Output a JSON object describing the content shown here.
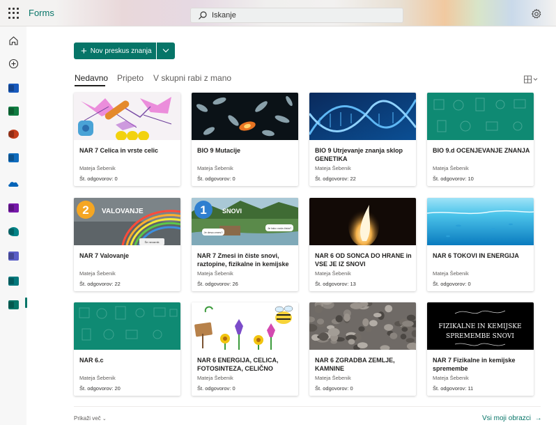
{
  "app": {
    "name": "Forms"
  },
  "search": {
    "placeholder": "Iskanje"
  },
  "rail": {
    "items": [
      {
        "name": "home-icon"
      },
      {
        "name": "create-icon"
      },
      {
        "name": "word-icon",
        "color": "#185abd"
      },
      {
        "name": "excel-icon",
        "color": "#107c41"
      },
      {
        "name": "powerpoint-icon",
        "color": "#c43e1c"
      },
      {
        "name": "outlook-icon",
        "color": "#0f6cbd"
      },
      {
        "name": "onedrive-icon",
        "color": "#0364b8"
      },
      {
        "name": "onenote-icon",
        "color": "#7719aa"
      },
      {
        "name": "sway-icon",
        "color": "#038387"
      },
      {
        "name": "teams-icon",
        "color": "#5b5fc7"
      },
      {
        "name": "sharepoint-icon",
        "color": "#03787c"
      },
      {
        "name": "forms-icon",
        "color": "#077568"
      }
    ]
  },
  "toolbar": {
    "new_quiz_label": "Nov preskus znanja"
  },
  "tabs": [
    "Nedavno",
    "Pripeto",
    "V skupni rabi z mano"
  ],
  "cards": [
    {
      "title": "NAR 7 Celica in vrste celic",
      "author": "Mateja Šebenik",
      "responses": "Št. odgovorov: 0",
      "thumb": "cells"
    },
    {
      "title": "BIO 9 Mutacije",
      "author": "Mateja Šebenik",
      "responses": "Št. odgovorov: 0",
      "thumb": "chromosomes"
    },
    {
      "title": "BIO 9 Utrjevanje znanja sklop GENETIKA",
      "author": "Mateja Šebenik",
      "responses": "Št. odgovorov: 22",
      "thumb": "dna"
    },
    {
      "title": "BIO 9.d OCENJEVANJE ZNANJA",
      "author": "Mateja Šebenik",
      "responses": "Št. odgovorov: 10",
      "thumb": "green"
    },
    {
      "title": "NAR 7 Valovanje",
      "author": "Mateja Šebenik",
      "responses": "Št. odgovorov: 22",
      "thumb": "rainbow",
      "badge": "2",
      "badge_text": "VALOVANJE",
      "bubble": "Še nevarnik"
    },
    {
      "title": "NAR 7 Zmesi in čiste snovi, raztopine, fizikalne in kemijske",
      "author": "Mateja Šebenik",
      "responses": "Št. odgovorov: 26",
      "thumb": "river",
      "badge": "1",
      "badge_text": "SNOVI",
      "bubble1": "Je desa zmes?",
      "bubble2": "Je tako voda čista?"
    },
    {
      "title": "NAR 6 OD SONCA DO HRANE in VSE JE IZ SNOVI",
      "author": "Mateja Šebenik",
      "responses": "Št. odgovorov: 13",
      "thumb": "flame"
    },
    {
      "title": "NAR 6 TOKOVI IN ENERGIJA",
      "author": "Mateja Šebenik",
      "responses": "Št. odgovorov: 0",
      "thumb": "ocean"
    },
    {
      "title": "NAR 6.c",
      "author": "Mateja Šebenik",
      "responses": "Št. odgovorov: 20",
      "thumb": "green"
    },
    {
      "title": "NAR 6 ENERGIJA, CELICA, FOTOSINTEZA, CELIČNO",
      "author": "Mateja Šebenik",
      "responses": "Št. odgovorov: 0",
      "thumb": "flowers"
    },
    {
      "title": "NAR 6 ZGRADBA ZEMLJE, KAMNINE",
      "author": "Mateja Šebenik",
      "responses": "Št. odgovorov: 0",
      "thumb": "stones"
    },
    {
      "title": "NAR 7 Fizikalne in kemijske spremembe",
      "author": "Mateja Šebenik",
      "responses": "Št. odgovorov: 11",
      "thumb": "blacktext",
      "thumb_line1": "FIZIKALNE IN KEMIJSKE",
      "thumb_line2": "SPREMEMBE SNOVI"
    }
  ],
  "footer": {
    "show_more": "Prikaži več",
    "all_forms": "Vsi moji obrazci"
  },
  "colors": {
    "brand": "#077568"
  }
}
